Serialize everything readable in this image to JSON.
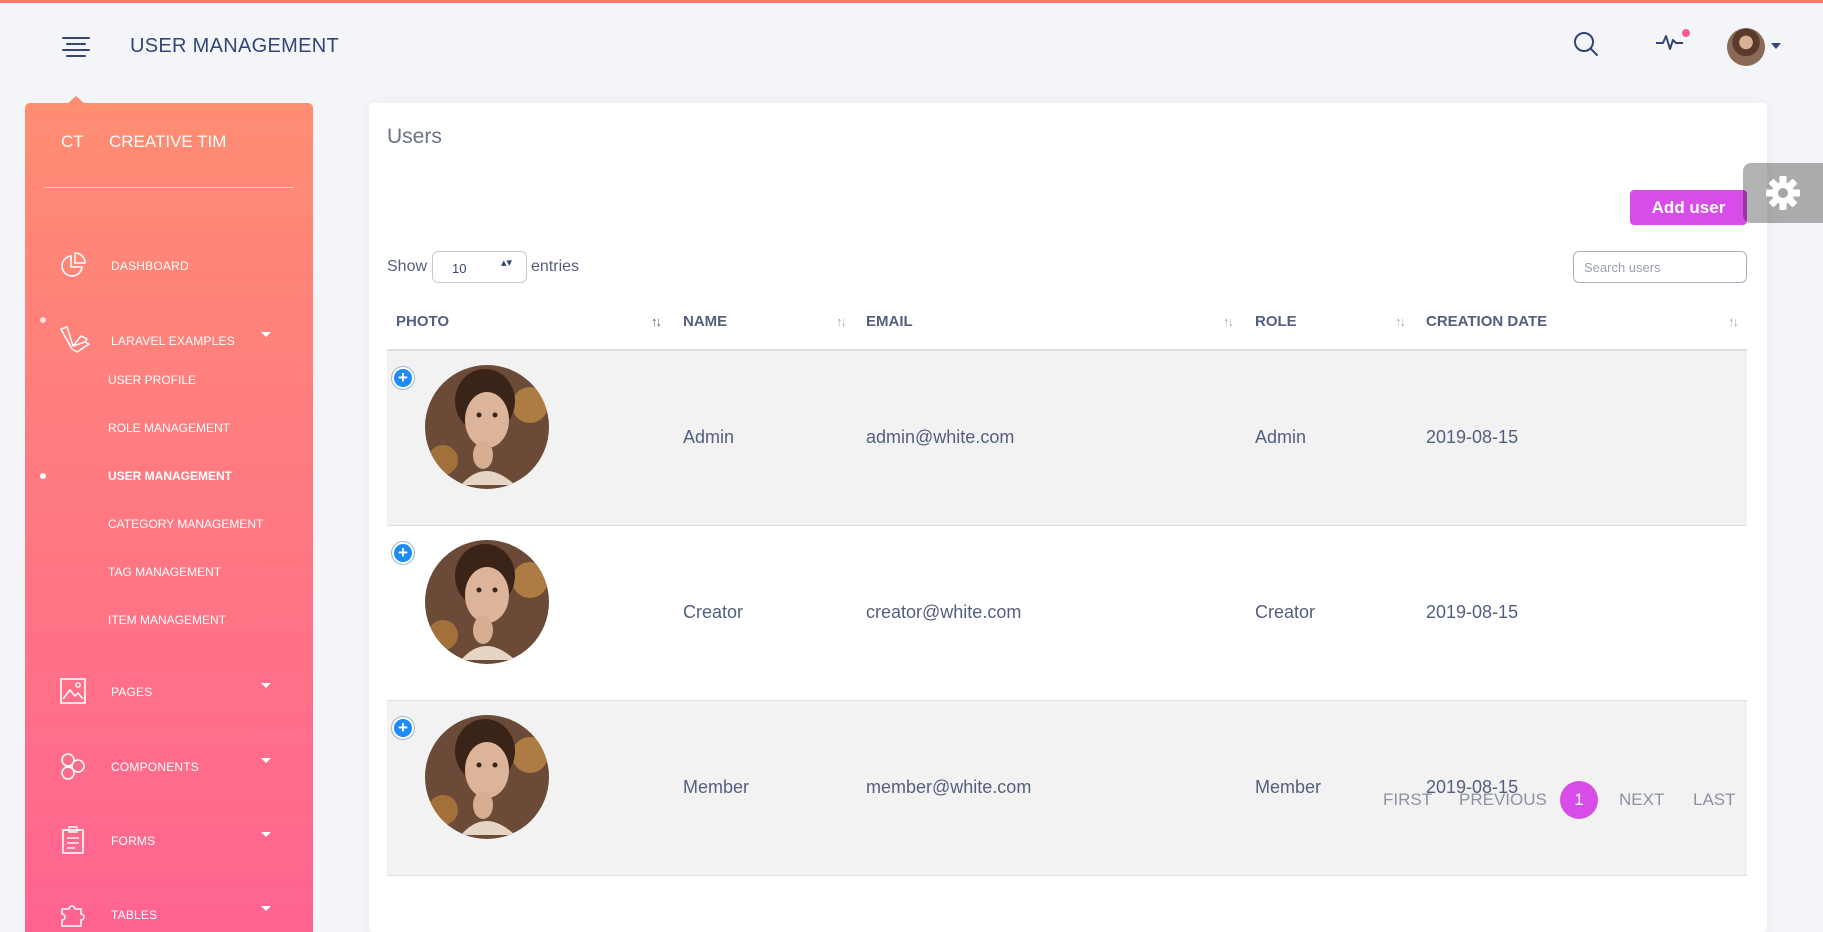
{
  "navbar": {
    "title": "USER MANAGEMENT",
    "icons": [
      "menu-icon",
      "search-icon",
      "activity-icon",
      "avatar"
    ]
  },
  "sidebar": {
    "brand_mini": "CT",
    "brand_name": "CREATIVE TIM",
    "items": [
      {
        "label": "Dashboard",
        "icon": "chart-pie-icon"
      },
      {
        "label": "Laravel Examples",
        "icon": "laravel-icon",
        "expanded": true
      },
      {
        "label": "Pages",
        "icon": "image-icon"
      },
      {
        "label": "Components",
        "icon": "components-icon"
      },
      {
        "label": "Forms",
        "icon": "clipboard-icon"
      },
      {
        "label": "Tables",
        "icon": "puzzle-icon"
      }
    ],
    "sub_items": [
      {
        "label": "User Profile"
      },
      {
        "label": "Role Management"
      },
      {
        "label": "User Management",
        "active": true
      },
      {
        "label": "Category Management"
      },
      {
        "label": "Tag Management"
      },
      {
        "label": "Item Management"
      }
    ]
  },
  "card": {
    "title": "Users",
    "add_button": "Add user",
    "show_label": "Show",
    "entries_value": "10",
    "entries_label": "entries",
    "search_placeholder": "Search users"
  },
  "table": {
    "columns": [
      "Photo",
      "Name",
      "Email",
      "Role",
      "Creation Date"
    ],
    "rows": [
      {
        "name": "Admin",
        "email": "admin@white.com",
        "role": "Admin",
        "created": "2019-08-15"
      },
      {
        "name": "Creator",
        "email": "creator@white.com",
        "role": "Creator",
        "created": "2019-08-15"
      },
      {
        "name": "Member",
        "email": "member@white.com",
        "role": "Member",
        "created": "2019-08-15"
      }
    ]
  },
  "pagination": {
    "first": "First",
    "previous": "Previous",
    "current": "1",
    "next": "Next",
    "last": "Last"
  },
  "colors": {
    "accent": "#d84dea",
    "sidebar_top": "#ff8d72",
    "sidebar_bottom": "#ff6491",
    "info": "#1d8cf8"
  }
}
